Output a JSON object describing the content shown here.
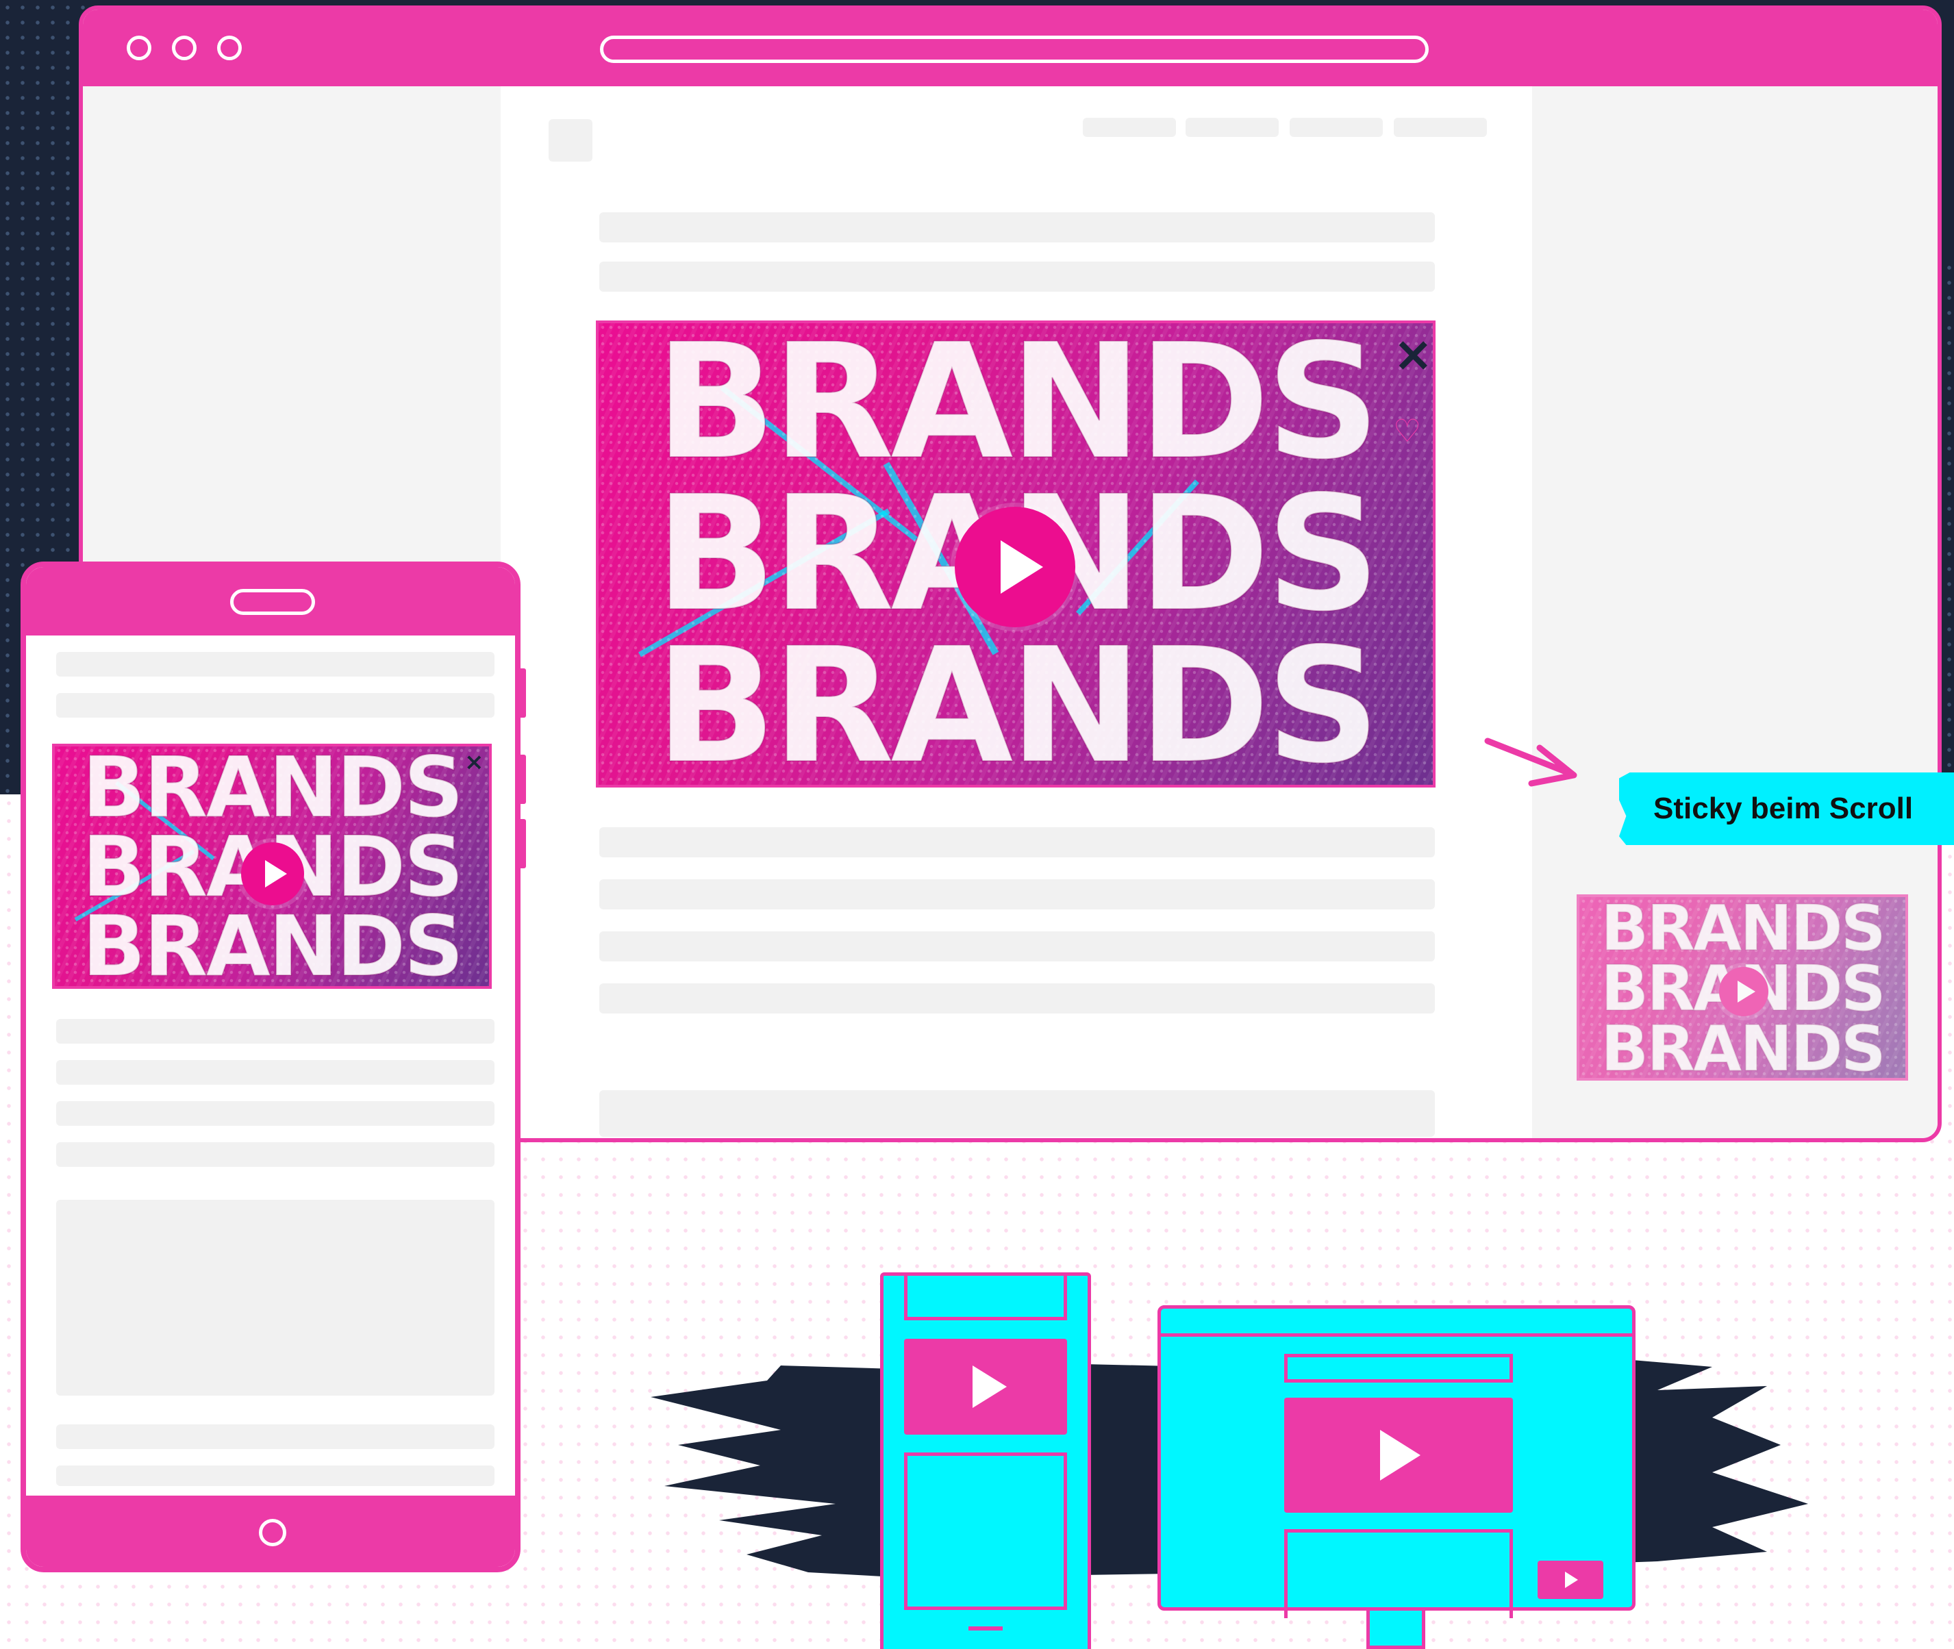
{
  "sticky": {
    "label": "Sticky beim Scroll"
  },
  "video": {
    "word": "BRANDS",
    "close_glyph": "×",
    "play_icon": "play-icon",
    "close_icon": "close-icon"
  },
  "colors": {
    "brand_pink": "#ec3aa7",
    "accent_cyan": "#00f7ff",
    "navy": "#1a2438",
    "placeholder_gray": "#f1f1f1"
  }
}
